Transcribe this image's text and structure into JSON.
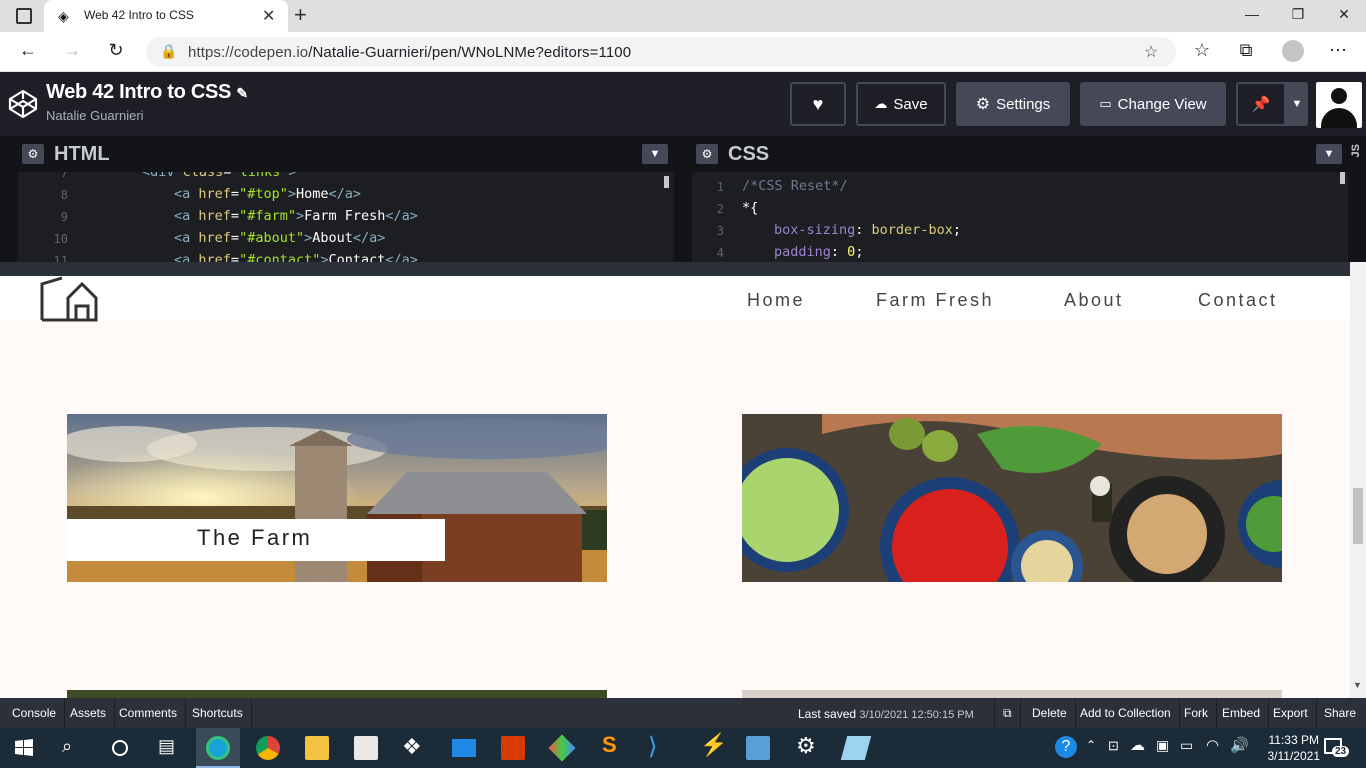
{
  "browser": {
    "tab_title": "Web 42 Intro to CSS",
    "url_host": "https://codepen.io",
    "url_path": "/Natalie-Guarnieri/pen/WNoLNMe?editors=1100"
  },
  "codepen": {
    "title": "Web 42 Intro to CSS",
    "author": "Natalie Guarnieri",
    "buttons": {
      "save": "Save",
      "settings": "Settings",
      "change_view": "Change View"
    }
  },
  "editors": {
    "html": {
      "label": "HTML",
      "line_numbers": [
        "7",
        "8",
        "9",
        "10",
        "11"
      ]
    },
    "css": {
      "label": "CSS",
      "line_numbers": [
        "1",
        "2",
        "3",
        "4"
      ]
    },
    "js_label": "JS"
  },
  "preview": {
    "nav": [
      "Home",
      "Farm Fresh",
      "About",
      "Contact"
    ],
    "card_label": "The Farm"
  },
  "footer": {
    "left": [
      "Console",
      "Assets",
      "Comments",
      "Shortcuts"
    ],
    "last_saved_label": "Last saved",
    "last_saved_value": "3/10/2021 12:50:15 PM",
    "right": [
      "Delete",
      "Add to Collection",
      "Fork",
      "Embed",
      "Export",
      "Share"
    ]
  },
  "taskbar": {
    "time": "11:33 PM",
    "date": "3/11/2021",
    "notifications": "23"
  }
}
